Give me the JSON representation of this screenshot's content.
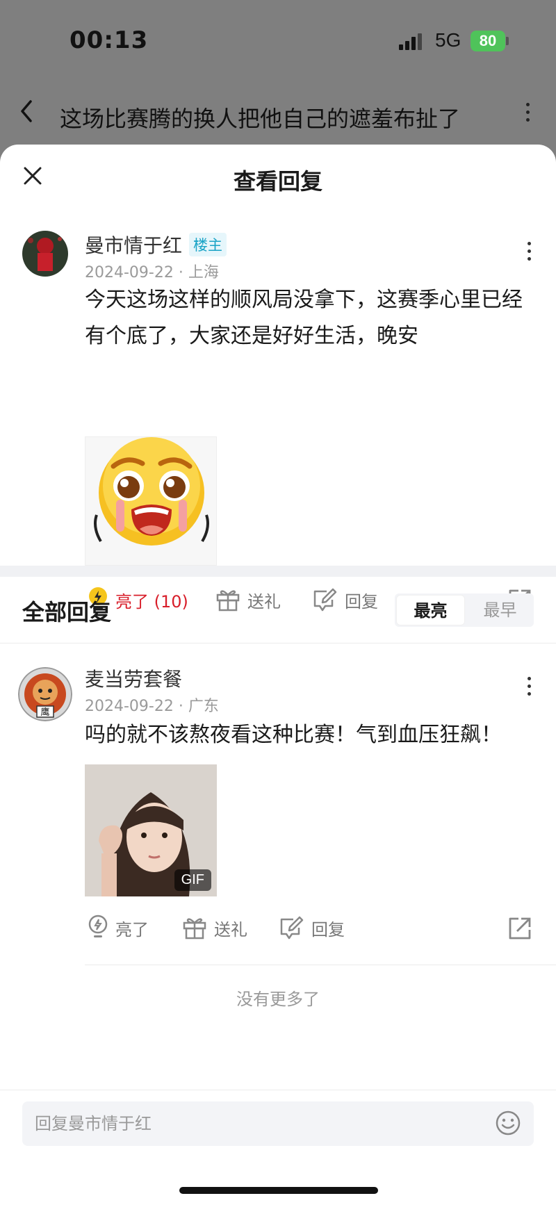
{
  "status_bar": {
    "time": "00:13",
    "network": "5G",
    "battery": "80"
  },
  "post_header": {
    "title": "这场比赛腾的换人把他自己的遮羞布扯了"
  },
  "sheet": {
    "title": "查看回复"
  },
  "main_comment": {
    "username": "曼市情于红",
    "badge": "楼主",
    "meta": "2024-09-22 · 上海",
    "text": "今天这场这样的顺风局没拿下，这赛季心里已经有个底了，大家还是好好生活，晚安",
    "actions": {
      "like": "亮了 (10)",
      "gift": "送礼",
      "reply": "回复"
    }
  },
  "replies_section": {
    "title": "全部回复",
    "sort_options": [
      "最亮",
      "最早"
    ],
    "sort_selected": "最亮"
  },
  "replies": [
    {
      "username": "麦当劳套餐",
      "meta": "2024-09-22 · 广东",
      "text": "吗的就不该熬夜看这种比赛！气到血压狂飙！",
      "media_tag": "GIF",
      "avatar_text": "鹰",
      "actions": {
        "like": "亮了",
        "gift": "送礼",
        "reply": "回复"
      }
    }
  ],
  "no_more": "没有更多了",
  "reply_box": {
    "placeholder": "回复曼市情于红"
  },
  "colors": {
    "accent_red": "#d81e2a",
    "badge_blue": "#19a3c6",
    "battery_green": "#4fc35a"
  }
}
